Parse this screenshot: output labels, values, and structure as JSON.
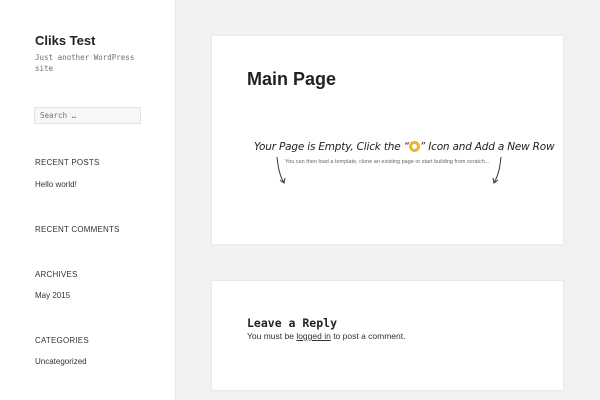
{
  "site": {
    "title": "Cliks Test",
    "description": "Just another WordPress site"
  },
  "search": {
    "placeholder": "Search …"
  },
  "widgets": {
    "recent_posts": {
      "title": "RECENT POSTS",
      "items": [
        "Hello world!"
      ]
    },
    "recent_comments": {
      "title": "RECENT COMMENTS"
    },
    "archives": {
      "title": "ARCHIVES",
      "items": [
        "May 2015"
      ]
    },
    "categories": {
      "title": "CATEGORIES",
      "items": [
        "Uncategorized"
      ]
    }
  },
  "main": {
    "title": "Main Page",
    "empty_headline_before": "Your Page is Empty, Click the “",
    "empty_headline_after": "” Icon and Add a New Row",
    "empty_sub": "You can then load a template, clone an existing page or start building from scratch..."
  },
  "comments": {
    "title": "Leave a Reply",
    "text_before": "You must be ",
    "login_link": "logged in",
    "text_after": " to post a comment."
  },
  "colors": {
    "background": "#f1f1f1",
    "card": "#ffffff",
    "builder_icon": "#f0b429"
  },
  "icons": {
    "builder": "builder-icon",
    "arrows": "down-arrow-icon"
  }
}
